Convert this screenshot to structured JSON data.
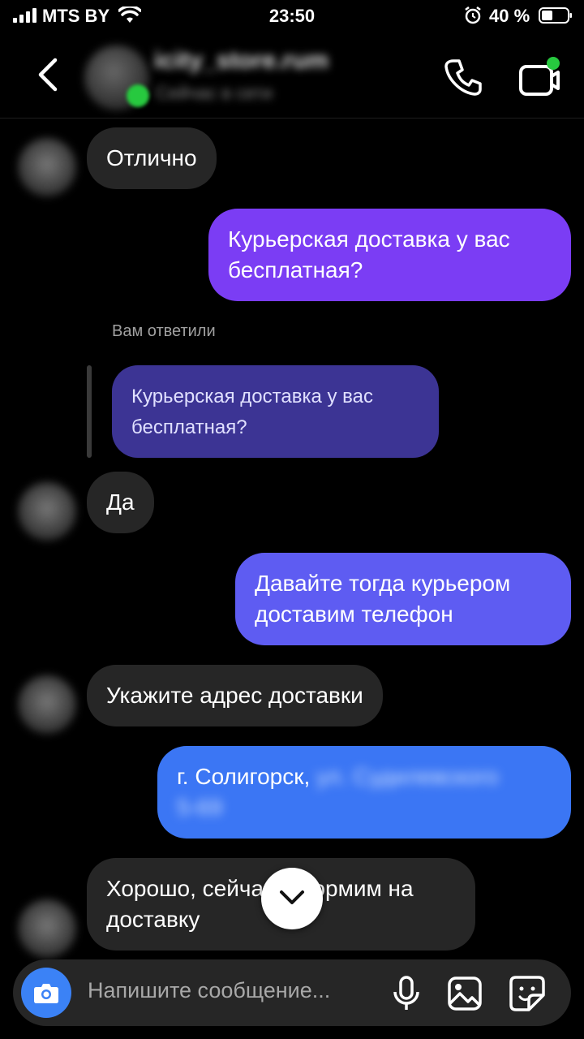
{
  "status_bar": {
    "carrier": "MTS BY",
    "time": "23:50",
    "battery_percent": "40 %"
  },
  "header": {
    "contact_name": "icity_store.rum",
    "contact_status": "Сейчас в сети"
  },
  "messages": [
    {
      "direction": "incoming",
      "text": "Отлично"
    },
    {
      "direction": "outgoing",
      "text_line1": "Курьерская доставка у вас",
      "text_line2": "бесплатная?"
    },
    {
      "reply_caption": "Вам ответили",
      "quoted_line1": "Курьерская доставка у вас",
      "quoted_line2": "бесплатная?"
    },
    {
      "direction": "incoming",
      "text": "Да"
    },
    {
      "direction": "outgoing",
      "text_line1": "Давайте тогда курьером",
      "text_line2": "доставим телефон"
    },
    {
      "direction": "incoming",
      "text": "Укажите адрес доставки"
    },
    {
      "direction": "outgoing",
      "text_visible": "г. Солигорск,",
      "text_blurred_line1": "ул. Судилевского",
      "text_blurred_line2": "5-69"
    },
    {
      "direction": "incoming",
      "text_line1": "Хорошо, сейчас оформим на",
      "text_line2": "доставку"
    }
  ],
  "composer": {
    "placeholder": "Напишите сообщение..."
  },
  "colors": {
    "background": "#000000",
    "incoming_bubble": "#262626",
    "outgoing_purple": "#7b3df4",
    "outgoing_indigo": "#5e5cf2",
    "outgoing_blue": "#3b76f4",
    "online": "#27c93f",
    "camera_button": "#3b82f6"
  },
  "icons": [
    "signal-icon",
    "wifi-icon",
    "alarm-icon",
    "battery-icon",
    "back-icon",
    "phone-icon",
    "video-call-icon",
    "chevron-down-icon",
    "camera-icon",
    "microphone-icon",
    "gallery-icon",
    "sticker-icon"
  ]
}
